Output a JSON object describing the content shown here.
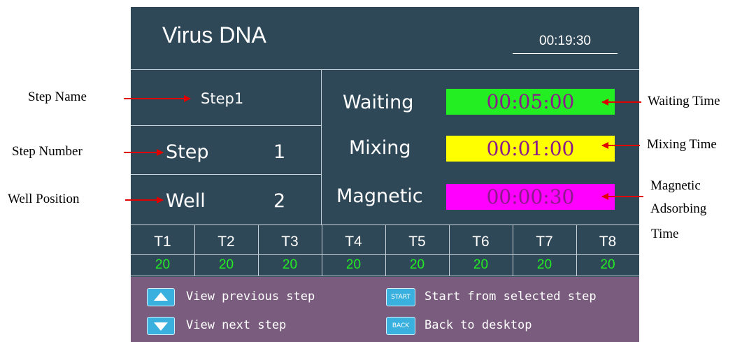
{
  "screen": {
    "title": "Virus DNA",
    "clock": "00:19:30",
    "step_name": "Step1",
    "step_label": "Step",
    "step_number": "1",
    "well_label": "Well",
    "well_number": "2",
    "timers": [
      {
        "label": "Waiting",
        "value": "00:05:00",
        "color": "#22ee22"
      },
      {
        "label": "Mixing",
        "value": "00:01:00",
        "color": "#ffff00"
      },
      {
        "label": "Magnetic",
        "value": "00:00:30",
        "color": "#ff00ff"
      }
    ],
    "temps": {
      "headers": [
        "T1",
        "T2",
        "T3",
        "T4",
        "T5",
        "T6",
        "T7",
        "T8"
      ],
      "values": [
        "20",
        "20",
        "20",
        "20",
        "20",
        "20",
        "20",
        "20"
      ]
    }
  },
  "footer": {
    "prev_label": "View previous step",
    "next_label": "View next step",
    "start_key": "START",
    "start_label": "Start from selected step",
    "back_key": "BACK",
    "back_label": "Back to desktop"
  },
  "annotations": {
    "step_name": "Step Name",
    "step_number": "Step Number",
    "well_position": "Well Position",
    "waiting_time": "Waiting Time",
    "mixing_time": "Mixing Time",
    "magnetic_line1": "Magnetic",
    "magnetic_line2": "Adsorbing",
    "magnetic_line3": "Time"
  }
}
